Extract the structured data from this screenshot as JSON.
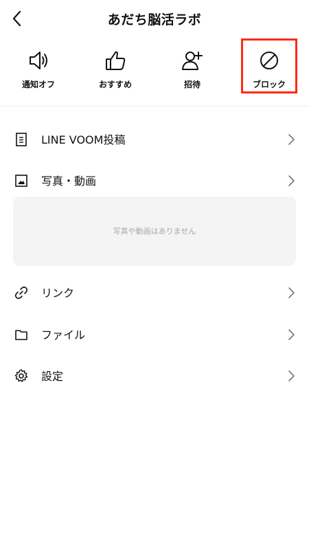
{
  "header": {
    "title": "あだち脳活ラボ",
    "back_icon": "chevron-left-icon"
  },
  "actions": [
    {
      "label": "通知オフ",
      "icon": "speaker-icon"
    },
    {
      "label": "おすすめ",
      "icon": "thumbs-up-icon"
    },
    {
      "label": "招待",
      "icon": "add-user-icon"
    },
    {
      "label": "ブロック",
      "icon": "block-icon"
    }
  ],
  "highlight_color": "#ff2a12",
  "menu": {
    "voom": "LINE VOOM投稿",
    "photos": "写真・動画",
    "photos_empty": "写真や動画はありません",
    "links": "リンク",
    "files": "ファイル",
    "settings": "設定"
  }
}
